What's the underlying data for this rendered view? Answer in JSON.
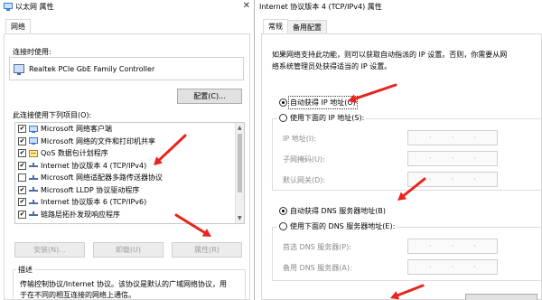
{
  "left_window": {
    "title": "以太网 属性",
    "tab": "网络",
    "connect_using_label": "连接时使用:",
    "adapter_name": "Realtek PCIe GbE Family Controller",
    "configure_button": "配置(C)...",
    "items_label": "此连接使用下列项目(O):",
    "items": [
      {
        "label": "Microsoft 网络客户端",
        "checked": true,
        "icon": "network-client-icon"
      },
      {
        "label": "Microsoft 网络的文件和打印机共享",
        "checked": true,
        "icon": "file-printer-share-icon"
      },
      {
        "label": "QoS 数据包计划程序",
        "checked": true,
        "icon": "qos-icon"
      },
      {
        "label": "Internet 协议版本 4 (TCP/IPv4)",
        "checked": true,
        "icon": "protocol-icon"
      },
      {
        "label": "Microsoft 网络适配器多路传送器协议",
        "checked": false,
        "icon": "protocol-icon"
      },
      {
        "label": "Microsoft LLDP 协议驱动程序",
        "checked": true,
        "icon": "protocol-icon"
      },
      {
        "label": "Internet 协议版本 6 (TCP/IPv6)",
        "checked": true,
        "icon": "protocol-icon"
      },
      {
        "label": "链路层拓扑发现响应程序",
        "checked": true,
        "icon": "protocol-icon"
      }
    ],
    "install_button": "安装(N)...",
    "uninstall_button": "卸载(U)",
    "properties_button": "属性(R)",
    "description_label": "描述",
    "description_line1": "传输控制协议/Internet 协议。该协议是默认的广域网络协议，用",
    "description_line2": "于在不同的相互连接的网络上通信。"
  },
  "right_window": {
    "title": "Internet 协议版本 4 (TCP/IPv4) 属性",
    "tabs": [
      "常规",
      "备用配置"
    ],
    "intro_line1": "如果网络支持此功能，则可以获取自动指派的 IP 设置。否则，你需要从网",
    "intro_line2": "络系统管理员处获得适当的 IP 设置。",
    "auto_ip_radio": "自动获得 IP 地址(O)",
    "manual_ip_radio": "使用下面的 IP 地址(S):",
    "ip_address_label": "IP 地址(I):",
    "subnet_label": "子网掩码(U):",
    "gateway_label": "默认网关(D):",
    "auto_dns_radio": "自动获得 DNS 服务器地址(B)",
    "manual_dns_radio": "使用下面的 DNS 服务器地址(E):",
    "preferred_dns_label": "首选 DNS 服务器(P):",
    "alternate_dns_label": "备用 DNS 服务器(A):",
    "ip_dots": "·"
  },
  "colors": {
    "arrow": "#e8241c",
    "title_icon": "#3a7bd5"
  }
}
